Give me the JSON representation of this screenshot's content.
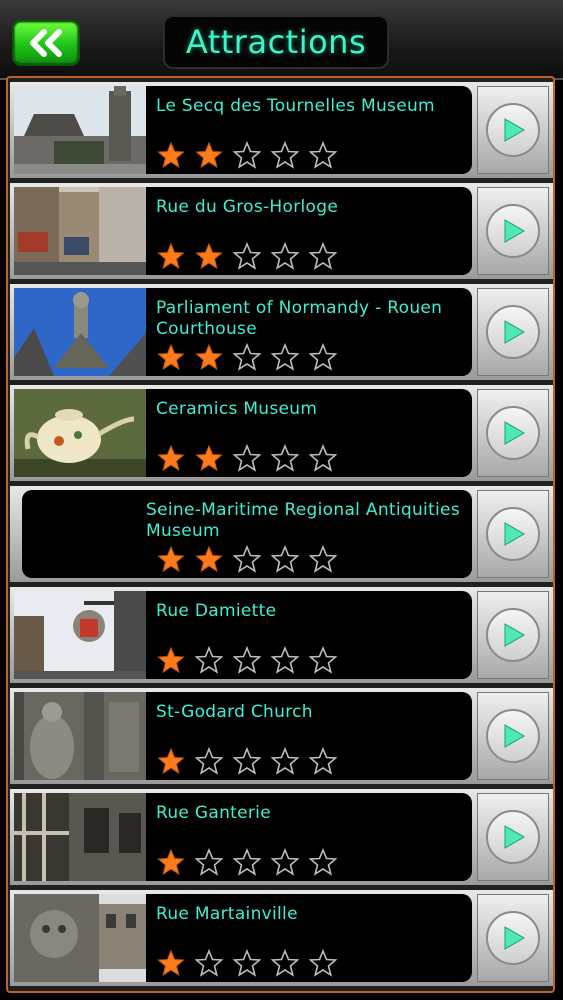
{
  "header": {
    "title": "Attractions",
    "back_icon": "double-chevron-left-icon"
  },
  "colors": {
    "accent_text": "#3cf0d4",
    "star_filled": "#ff7a18",
    "back_button": "#1fc21a",
    "list_border": "#c0612a"
  },
  "attractions": [
    {
      "name": "Le Secq des Tournelles Museum",
      "rating": 2
    },
    {
      "name": "Rue du Gros-Horloge",
      "rating": 2
    },
    {
      "name": "Parliament of Normandy - Rouen Courthouse",
      "rating": 2
    },
    {
      "name": "Ceramics Museum",
      "rating": 2
    },
    {
      "name": "Seine-Maritime Regional Antiquities Museum",
      "rating": 2
    },
    {
      "name": "Rue Damiette",
      "rating": 1
    },
    {
      "name": "St-Godard Church",
      "rating": 1
    },
    {
      "name": "Rue Ganterie",
      "rating": 1
    },
    {
      "name": "Rue Martainville",
      "rating": 1
    }
  ],
  "max_rating": 5
}
